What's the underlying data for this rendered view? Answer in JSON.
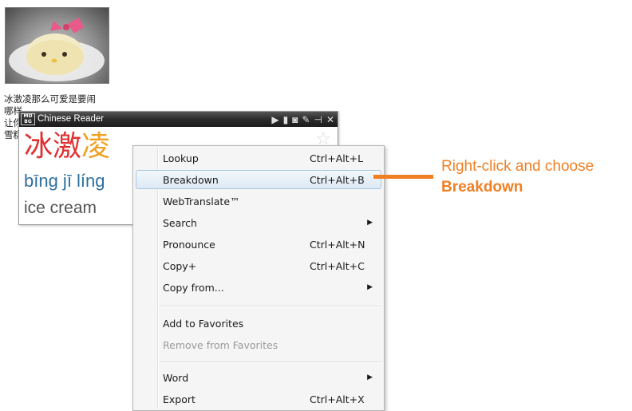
{
  "page": {
    "paragraph_lines": [
      "冰激凌那么可爱是要闹",
      "哪样……",
      "让你",
      "雪糕"
    ]
  },
  "popup": {
    "logo_text": "MD BG",
    "title": "Chinese Reader",
    "toolbar_icons": [
      "play-icon",
      "bin-icon",
      "camera-icon",
      "wrench-icon",
      "pin-icon",
      "close-icon"
    ],
    "hanzi": [
      "冰",
      "激",
      "凌"
    ],
    "hanzi_colors": [
      "#e03030",
      "#e03030",
      "#f0a020"
    ],
    "pinyin": "bīng jī líng",
    "english": "ice cream"
  },
  "menu": {
    "items": [
      {
        "label": "Lookup",
        "shortcut": "Ctrl+Alt+L"
      },
      {
        "label": "Breakdown",
        "shortcut": "Ctrl+Alt+B",
        "highlighted": true
      },
      {
        "label": "WebTranslate™",
        "shortcut": ""
      },
      {
        "label": "Search",
        "submenu": true
      },
      {
        "label": "Pronounce",
        "shortcut": "Ctrl+Alt+N"
      },
      {
        "label": "Copy+",
        "shortcut": "Ctrl+Alt+C"
      },
      {
        "label": "Copy from...",
        "submenu": true
      },
      {
        "label": "Add to Favorites",
        "shortcut": ""
      },
      {
        "label": "Remove from Favorites",
        "shortcut": "",
        "disabled": true
      },
      {
        "label": "Word",
        "submenu": true
      },
      {
        "label": "Export",
        "shortcut": "Ctrl+Alt+X"
      }
    ]
  },
  "callout": {
    "line1": "Right-click and choose",
    "line2": "Breakdown",
    "color": "#f07f24"
  }
}
